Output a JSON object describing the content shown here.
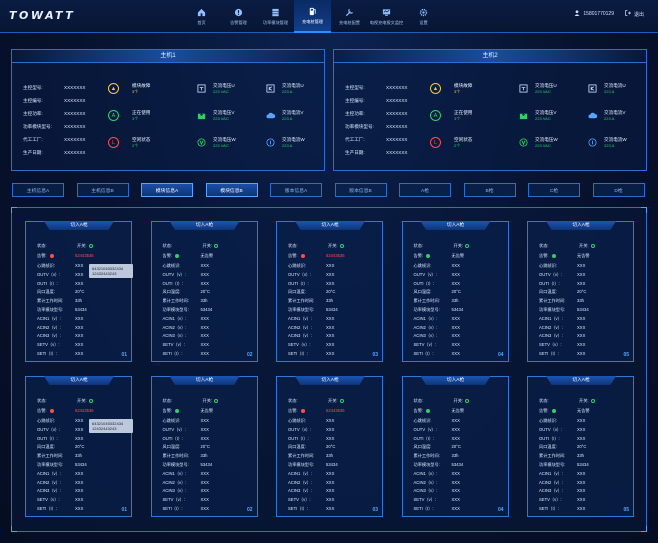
{
  "app": {
    "logo": "TOWATT"
  },
  "nav": [
    {
      "label": "首页",
      "icon": "home-icon",
      "active": false
    },
    {
      "label": "告警管理",
      "icon": "alarm-icon",
      "active": false
    },
    {
      "label": "功率模块管理",
      "icon": "module-icon",
      "active": false
    },
    {
      "label": "充电桩管理",
      "icon": "charger-icon",
      "active": true
    },
    {
      "label": "充电桩配置",
      "icon": "config-icon",
      "active": false
    },
    {
      "label": "电视充电报文监控",
      "icon": "monitor-icon",
      "active": false
    },
    {
      "label": "设置",
      "icon": "gear-icon",
      "active": false
    }
  ],
  "header": {
    "user": "15801770129",
    "logout": "退出"
  },
  "hosts": [
    {
      "title": "主机1",
      "fields": [
        {
          "label": "主控型号:",
          "value": "XXXXXXX"
        },
        {
          "label": "主控编号:",
          "value": "XXXXXXX"
        },
        {
          "label": "主控功率:",
          "value": "XXXXXXX"
        },
        {
          "label": "功率模块型号:",
          "value": "XXXXXXX"
        },
        {
          "label": "代工工厂:",
          "value": "XXXXXXX"
        },
        {
          "label": "生产日期:",
          "value": "XXXXXXX"
        }
      ],
      "statuses": [
        {
          "label": "模块故障",
          "count": "3个",
          "icon": "warning-icon",
          "color": "#f2c94c"
        },
        {
          "label": "正在使用",
          "count": "3个",
          "icon": "in-use-icon",
          "color": "#2fd06a"
        },
        {
          "label": "空闲状态",
          "count": "2个",
          "icon": "idle-icon",
          "color": "#ff4d4d"
        }
      ],
      "meters": [
        {
          "label": "交流电压U",
          "value": "223 VAC",
          "icon": "voltage-icon"
        },
        {
          "label": "交流电流U",
          "value": "223 A",
          "icon": "current-icon"
        },
        {
          "label": "交流电压V",
          "value": "223 VAC",
          "icon": "voltage-icon"
        },
        {
          "label": "交流电流V",
          "value": "223 A",
          "icon": "current-icon"
        },
        {
          "label": "交流电压W",
          "value": "223 VAC",
          "icon": "voltage-icon"
        },
        {
          "label": "交流电流W",
          "value": "223 A",
          "icon": "current-icon"
        }
      ]
    },
    {
      "title": "主机2",
      "fields": [
        {
          "label": "主控型号:",
          "value": "XXXXXXX"
        },
        {
          "label": "主控编号:",
          "value": "XXXXXXX"
        },
        {
          "label": "主控功率:",
          "value": "XXXXXXX"
        },
        {
          "label": "功率模块型号:",
          "value": "XXXXXXX"
        },
        {
          "label": "代工工厂:",
          "value": "XXXXXXX"
        },
        {
          "label": "生产日期:",
          "value": "XXXXXXX"
        }
      ],
      "statuses": [
        {
          "label": "模块故障",
          "count": "3个",
          "icon": "warning-icon",
          "color": "#f2c94c"
        },
        {
          "label": "正在使用",
          "count": "3个",
          "icon": "in-use-icon",
          "color": "#2fd06a"
        },
        {
          "label": "空闲状态",
          "count": "2个",
          "icon": "idle-icon",
          "color": "#ff4d4d"
        }
      ],
      "meters": [
        {
          "label": "交流电压U",
          "value": "223 VAC",
          "icon": "voltage-icon"
        },
        {
          "label": "交流电流U",
          "value": "223 A",
          "icon": "current-icon"
        },
        {
          "label": "交流电压V",
          "value": "223 VAC",
          "icon": "voltage-icon"
        },
        {
          "label": "交流电流V",
          "value": "223 A",
          "icon": "current-icon"
        },
        {
          "label": "交流电压W",
          "value": "223 VAC",
          "icon": "voltage-icon"
        },
        {
          "label": "交流电流W",
          "value": "223 A",
          "icon": "current-icon"
        }
      ]
    }
  ],
  "tabs": [
    {
      "label": "主机信息A",
      "active": false
    },
    {
      "label": "主机信息B",
      "active": false
    },
    {
      "label": "模块信息A",
      "active": true
    },
    {
      "label": "模块信息B",
      "active": true
    },
    {
      "label": "版本信息A",
      "active": false
    },
    {
      "label": "版本信息B",
      "active": false
    },
    {
      "label": "A枪",
      "active": false
    },
    {
      "label": "B枪",
      "active": false
    },
    {
      "label": "C枪",
      "active": false
    },
    {
      "label": "D枪",
      "active": false
    }
  ],
  "card_labels": {
    "title": "切入A枪",
    "status": "状态:",
    "switch": "开关:",
    "alarm": "告警:",
    "heartbeat": "心跳帧识:",
    "outv": "OUTV（v）:",
    "outi": "OUTI（I）:",
    "temp": "风口温度:",
    "worktime": "累计工作时间:",
    "module_no": "功率模块型号:",
    "acin1": "ACIN1（v）:",
    "acin2": "ACIN2（v）:",
    "acin3": "ACIN3（v）:",
    "setv": "SETV（v）:",
    "seti": "SETI（I）:"
  },
  "cards": [
    {
      "num": "01",
      "alarm": "52443536",
      "alarm_state": "fault",
      "tooltip": [
        "64321045332434",
        "12432443243"
      ]
    },
    {
      "num": "02",
      "alarm": "无告警",
      "alarm_state": "ok"
    },
    {
      "num": "03",
      "alarm": "52443536",
      "alarm_state": "fault"
    },
    {
      "num": "04",
      "alarm": "无告警",
      "alarm_state": "ok"
    },
    {
      "num": "05",
      "alarm": "无告警",
      "alarm_state": "ok"
    },
    {
      "num": "01",
      "alarm": "52443536",
      "alarm_state": "fault",
      "tooltip": [
        "64321045332434",
        "12432443243"
      ]
    },
    {
      "num": "02",
      "alarm": "无告警",
      "alarm_state": "ok"
    },
    {
      "num": "03",
      "alarm": "52443536",
      "alarm_state": "fault"
    },
    {
      "num": "04",
      "alarm": "无告警",
      "alarm_state": "ok"
    },
    {
      "num": "05",
      "alarm": "无告警",
      "alarm_state": "ok"
    }
  ],
  "card_values": {
    "heartbeat": "XXX",
    "outv": "XXX",
    "outi": "XXX",
    "temp": "20°C",
    "worktime": "33h",
    "module_no": "53434",
    "acin1": "XXX",
    "acin2": "XXX",
    "acin3": "XXX",
    "setv": "XXX",
    "seti": "XXX"
  },
  "colors": {
    "accent": "#2f8cff",
    "ok": "#2fd06a",
    "fault": "#ff4d4d",
    "warn": "#f2c94c"
  }
}
